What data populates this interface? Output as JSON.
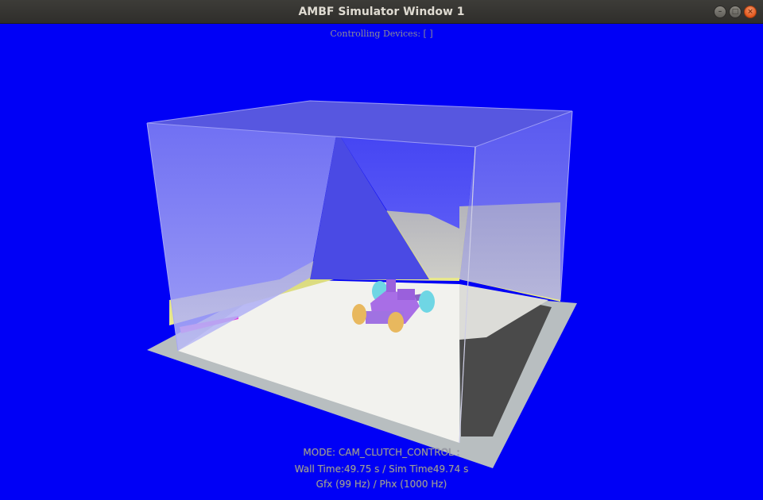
{
  "window": {
    "title": "AMBF Simulator Window 1",
    "buttons": {
      "minimize": "–",
      "maximize": "□",
      "close": "×"
    }
  },
  "hud": {
    "controlling_devices": "Controlling Devices: [ ]",
    "mode": "MODE: CAM_CLUTCH_CONTROL :",
    "time": "Wall Time:49.75 s / Sim Time49.74 s",
    "frequency": "Gfx (99 Hz) / Phx (1000 Hz)"
  },
  "colors": {
    "background": "#0000f6",
    "floor": "#f0f0ec",
    "floor_border": "#b8bec0",
    "box_top": "#5757e0",
    "box_face": "#9c9cf0",
    "wall": "#dede86",
    "car_body": "#a86ee6",
    "wheel_front": "#6fd6e4",
    "wheel_rear": "#e8b85e"
  }
}
